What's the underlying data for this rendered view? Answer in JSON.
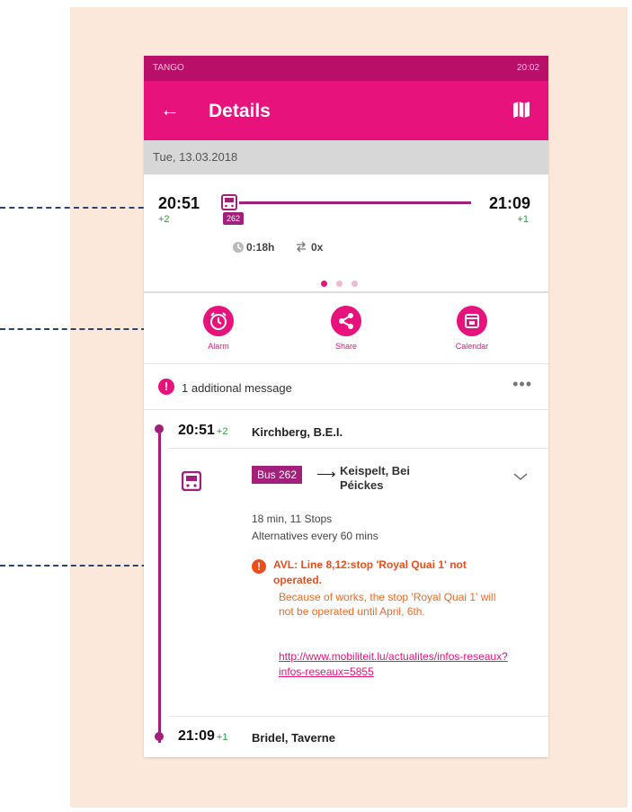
{
  "status_bar": {
    "left": "TANGO",
    "right": "20:02"
  },
  "app_bar": {
    "title": "Details",
    "back_icon": "arrow-left-icon",
    "map_icon": "map-icon"
  },
  "date": "Tue, 13.03.2018",
  "summary": {
    "departure_time": "20:51",
    "departure_delay": "+2",
    "arrival_time": "21:09",
    "arrival_delay": "+1",
    "line_badge": "262",
    "duration": "0:18h",
    "changes": "0x",
    "pages": {
      "count": 3,
      "active": 0
    }
  },
  "actions": [
    {
      "label": "Alarm",
      "icon": "alarm-icon"
    },
    {
      "label": "Share",
      "icon": "share-icon"
    },
    {
      "label": "Calendar",
      "icon": "calendar-icon"
    }
  ],
  "message": {
    "text": "1 additional message",
    "more": "•••"
  },
  "itinerary": {
    "start": {
      "time": "20:51",
      "delay": "+2",
      "stop": "Kirchberg, B.E.I."
    },
    "leg": {
      "line": "Bus 262",
      "arrow": "⟶",
      "destination": "Keispelt, Bei Péickes",
      "duration_stops": "18 min, 11 Stops",
      "alternatives": "Alternatives every 60 mins"
    },
    "warning": {
      "title": "AVL: Line 8,12:stop 'Royal Quai 1' not operated.",
      "body": "Because of works, the stop 'Royal Quai 1' will not be operated until April, 6th.",
      "link": "http://www.mobiliteit.lu/actualites/infos-reseaux?infos-reseaux=5855"
    },
    "end": {
      "time": "21:09",
      "delay": "+1",
      "stop": "Bridel, Taverne"
    }
  },
  "colors": {
    "primary": "#e8127c",
    "status_bar": "#ba0f69",
    "route": "#a3207a",
    "warning": "#ec4d1a",
    "delay_green": "#2e9e3e",
    "panel": "#fbe8db",
    "dash": "#2b4470"
  }
}
